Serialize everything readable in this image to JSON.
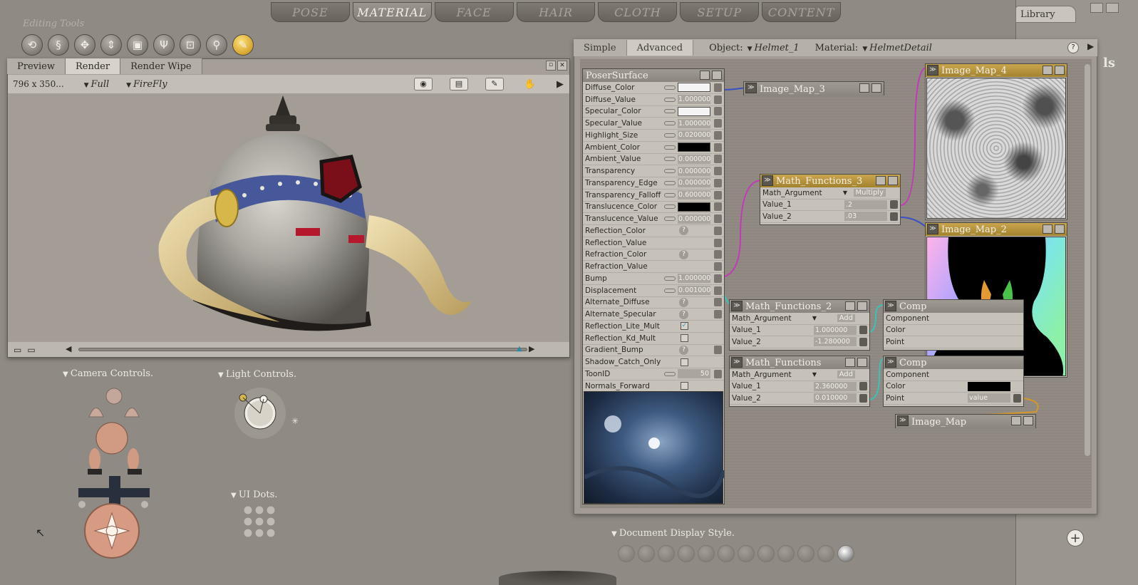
{
  "top_tabs": [
    "POSE",
    "MATERIAL",
    "FACE",
    "HAIR",
    "CLOTH",
    "SETUP",
    "CONTENT"
  ],
  "active_top_tab": "MATERIAL",
  "editing_tools": {
    "label": "Editing Tools",
    "tools": [
      {
        "name": "rotate-icon",
        "glyph": "⟲"
      },
      {
        "name": "twist-icon",
        "glyph": "§"
      },
      {
        "name": "translate-icon",
        "glyph": "✥"
      },
      {
        "name": "translate-in-out-icon",
        "glyph": "⇕"
      },
      {
        "name": "scale-icon",
        "glyph": "▣"
      },
      {
        "name": "taper-icon",
        "glyph": "Ψ"
      },
      {
        "name": "chain-break-icon",
        "glyph": "⊡"
      },
      {
        "name": "zoom-icon",
        "glyph": "⚲"
      },
      {
        "name": "eyedropper-icon",
        "glyph": "✎"
      }
    ]
  },
  "library": {
    "tab": "Library",
    "edge_text": "ls",
    "add_glyph": "+"
  },
  "document": {
    "tabs": [
      "Preview",
      "Render",
      "Render Wipe"
    ],
    "active_tab": "Render",
    "size": "796 x 350...",
    "mode": "Full",
    "renderer": "FireFly",
    "toolbar_icons": [
      "camera-icon",
      "render-settings-icon",
      "render-icon",
      "grab-icon"
    ]
  },
  "controls": {
    "camera": "Camera Controls.",
    "light": "Light Controls.",
    "ui_dots": "UI Dots.",
    "doc_style": "Document Display Style."
  },
  "material_room": {
    "tabs": [
      "Simple",
      "Advanced"
    ],
    "active_tab": "Advanced",
    "object_label": "Object:",
    "object_value": "Helmet_1",
    "material_label": "Material:",
    "material_value": "HelmetDetail",
    "help_glyph": "?",
    "menu_glyph": "▶"
  },
  "poser_surface": {
    "title": "PoserSurface",
    "rows": [
      {
        "label": "Diffuse_Color",
        "kind": "color",
        "color": "#f4f4f4"
      },
      {
        "label": "Diffuse_Value",
        "kind": "value",
        "value": "1.000000"
      },
      {
        "label": "Specular_Color",
        "kind": "color",
        "color": "#f4f4f4"
      },
      {
        "label": "Specular_Value",
        "kind": "value",
        "value": "1.000000"
      },
      {
        "label": "Highlight_Size",
        "kind": "value",
        "value": "0.020000"
      },
      {
        "label": "Ambient_Color",
        "kind": "color",
        "color": "#000000"
      },
      {
        "label": "Ambient_Value",
        "kind": "value",
        "value": "0.000000"
      },
      {
        "label": "Transparency",
        "kind": "value",
        "value": "0.000000"
      },
      {
        "label": "Transparency_Edge",
        "kind": "value",
        "value": "0.000000"
      },
      {
        "label": "Transparency_Falloff",
        "kind": "value",
        "value": "0.600000"
      },
      {
        "label": "Translucence_Color",
        "kind": "color",
        "color": "#000000"
      },
      {
        "label": "Translucence_Value",
        "kind": "value",
        "value": "0.000000"
      },
      {
        "label": "Reflection_Color",
        "kind": "q"
      },
      {
        "label": "Reflection_Value",
        "kind": "none"
      },
      {
        "label": "Refraction_Color",
        "kind": "q"
      },
      {
        "label": "Refraction_Value",
        "kind": "none"
      },
      {
        "label": "Bump",
        "kind": "value",
        "value": "1.000000"
      },
      {
        "label": "Displacement",
        "kind": "value",
        "value": "0.001000"
      },
      {
        "label": "Alternate_Diffuse",
        "kind": "q"
      },
      {
        "label": "Alternate_Specular",
        "kind": "q"
      },
      {
        "label": "Reflection_Lite_Mult",
        "kind": "check",
        "checked": true
      },
      {
        "label": "Reflection_Kd_Mult",
        "kind": "check",
        "checked": false
      },
      {
        "label": "Gradient_Bump",
        "kind": "q"
      },
      {
        "label": "Shadow_Catch_Only",
        "kind": "check",
        "checked": false
      },
      {
        "label": "ToonID",
        "kind": "value",
        "value": "50"
      },
      {
        "label": "Normals_Forward",
        "kind": "check",
        "checked": false
      }
    ]
  },
  "nodes": {
    "image_map_3": {
      "title": "Image_Map_3"
    },
    "image_map_4": {
      "title": "Image_Map_4"
    },
    "image_map_2": {
      "title": "Image_Map_2"
    },
    "image_map": {
      "title": "Image_Map"
    },
    "math_functions_3": {
      "title": "Math_Functions_3",
      "rows": [
        {
          "label": "Math_Argument",
          "dropdown": "Multiply"
        },
        {
          "label": "Value_1",
          "value": ".2"
        },
        {
          "label": "Value_2",
          "value": ".03"
        }
      ]
    },
    "math_functions_2": {
      "title": "Math_Functions_2",
      "rows": [
        {
          "label": "Math_Argument",
          "dropdown": "Add"
        },
        {
          "label": "Value_1",
          "value": "1.000000"
        },
        {
          "label": "Value_2",
          "value": "-1.280000"
        }
      ]
    },
    "math_functions": {
      "title": "Math_Functions",
      "rows": [
        {
          "label": "Math_Argument",
          "dropdown": "Add"
        },
        {
          "label": "Value_1",
          "value": "2.360000"
        },
        {
          "label": "Value_2",
          "value": "0.010000"
        }
      ]
    },
    "comp_a": {
      "title": "Comp",
      "rows": [
        {
          "label": "Component"
        },
        {
          "label": "Color"
        },
        {
          "label": "Point"
        }
      ]
    },
    "comp_b": {
      "title": "Comp",
      "rows": [
        {
          "label": "Component"
        },
        {
          "label": "Color",
          "swatch": "#000000"
        },
        {
          "label": "Point",
          "value": "value"
        }
      ]
    }
  },
  "colors": {
    "accent_gold": "#c9a64d",
    "wire_magenta": "#c23ab8",
    "wire_blue": "#3a4fc2",
    "wire_cyan": "#3ac2b8",
    "wire_orange": "#d6962a"
  }
}
